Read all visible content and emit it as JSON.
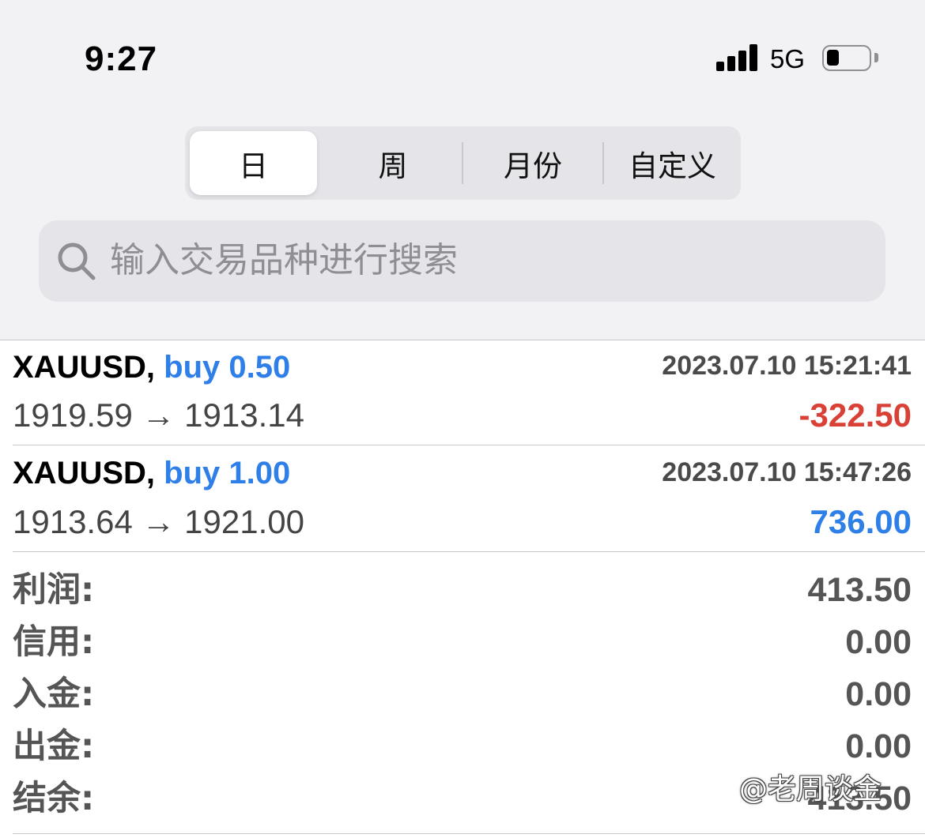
{
  "status_bar": {
    "time": "9:27",
    "network": "5G",
    "battery_level": 0.3
  },
  "period_tabs": [
    {
      "label": "日",
      "active": true
    },
    {
      "label": "周",
      "active": false
    },
    {
      "label": "月份",
      "active": false
    },
    {
      "label": "自定义",
      "active": false
    }
  ],
  "search": {
    "placeholder": "输入交易品种进行搜索"
  },
  "trades": [
    {
      "symbol": "XAUUSD,",
      "side_volume": "buy 0.50",
      "time": "2023.07.10 15:21:41",
      "prices": "1919.59 → 1913.14",
      "profit": "-322.50"
    },
    {
      "symbol": "XAUUSD,",
      "side_volume": "buy 1.00",
      "time": "2023.07.10 15:47:26",
      "prices": "1913.64 → 1921.00",
      "profit": "736.00"
    }
  ],
  "summary": [
    {
      "label": "利润:",
      "value": "413.50"
    },
    {
      "label": "信用:",
      "value": "0.00"
    },
    {
      "label": "入金:",
      "value": "0.00"
    },
    {
      "label": "出金:",
      "value": "0.00"
    },
    {
      "label": "结余:",
      "value": "413.50"
    }
  ],
  "watermark": "@老周谈金",
  "colors": {
    "buy": "#2f7fe8",
    "loss": "#d94137",
    "profit": "#2f7fe8"
  }
}
